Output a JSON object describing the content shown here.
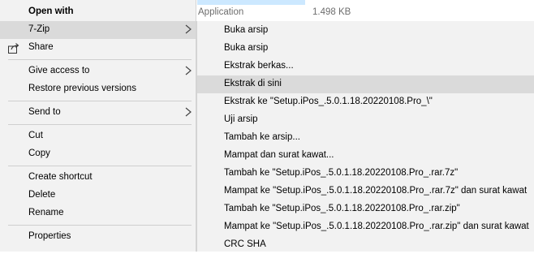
{
  "background": {
    "file_type": "Application",
    "file_size": "1.498 KB",
    "selection_color": "#cce8ff"
  },
  "menu": {
    "open_with": "Open with",
    "seven_zip": "7-Zip",
    "share": "Share",
    "give_access": "Give access to",
    "restore": "Restore previous versions",
    "send_to": "Send to",
    "cut": "Cut",
    "copy": "Copy",
    "create_shortcut": "Create shortcut",
    "delete": "Delete",
    "rename": "Rename",
    "properties": "Properties"
  },
  "submenu": {
    "items": [
      "Buka arsip",
      "Buka arsip",
      "Ekstrak berkas...",
      "Ekstrak di sini",
      "Ekstrak ke \"Setup.iPos_.5.0.1.18.20220108.Pro_\\\"",
      "Uji arsip",
      "Tambah ke arsip...",
      "Mampat dan surat kawat...",
      "Tambah ke \"Setup.iPos_.5.0.1.18.20220108.Pro_.rar.7z\"",
      "Mampat ke \"Setup.iPos_.5.0.1.18.20220108.Pro_.rar.7z\" dan surat kawat",
      "Tambah ke \"Setup.iPos_.5.0.1.18.20220108.Pro_.rar.zip\"",
      "Mampat ke \"Setup.iPos_.5.0.1.18.20220108.Pro_.rar.zip\" dan surat kawat",
      "CRC SHA"
    ],
    "highlighted": "Ekstrak di sini"
  },
  "icons": {
    "share": "share-icon",
    "submenu_arrow": "chevron-right-icon"
  },
  "colors": {
    "menu_bg": "#f2f2f2",
    "hover_bg": "#dadada"
  }
}
